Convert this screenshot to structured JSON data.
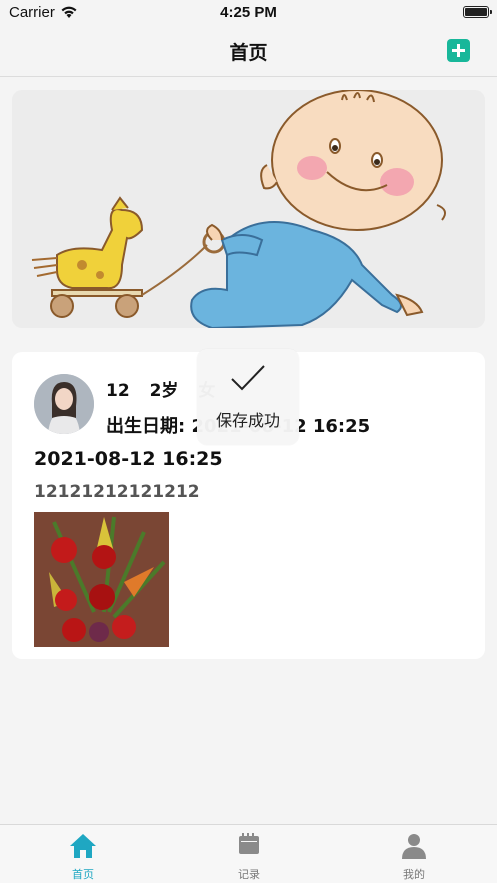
{
  "status_bar": {
    "carrier": "Carrier",
    "time": "4:25 PM",
    "wifi_icon": "wifi-icon",
    "battery_icon": "battery-icon"
  },
  "nav": {
    "title": "首页",
    "add_icon": "plus-icon",
    "accent_color": "#18b79a"
  },
  "banner": {
    "image": "cartoon-baby-pulling-wooden-horse-toy"
  },
  "record_card": {
    "baby_name": "12",
    "age": "2岁",
    "gender": "女",
    "birth_label": "出生日期:",
    "birth_value": "2021-08-12 16:25",
    "record_time": "2021-08-12 16:25",
    "content": "12121212121212",
    "avatar": "avatar-photo",
    "photo": "flower-arrangement-photo"
  },
  "toast": {
    "icon": "checkmark-icon",
    "message": "保存成功"
  },
  "tab_bar": {
    "active_color": "#1fa7c2",
    "items": [
      {
        "label": "首页",
        "icon": "home-icon"
      },
      {
        "label": "记录",
        "icon": "calendar-icon"
      },
      {
        "label": "我的",
        "icon": "person-icon"
      }
    ]
  }
}
